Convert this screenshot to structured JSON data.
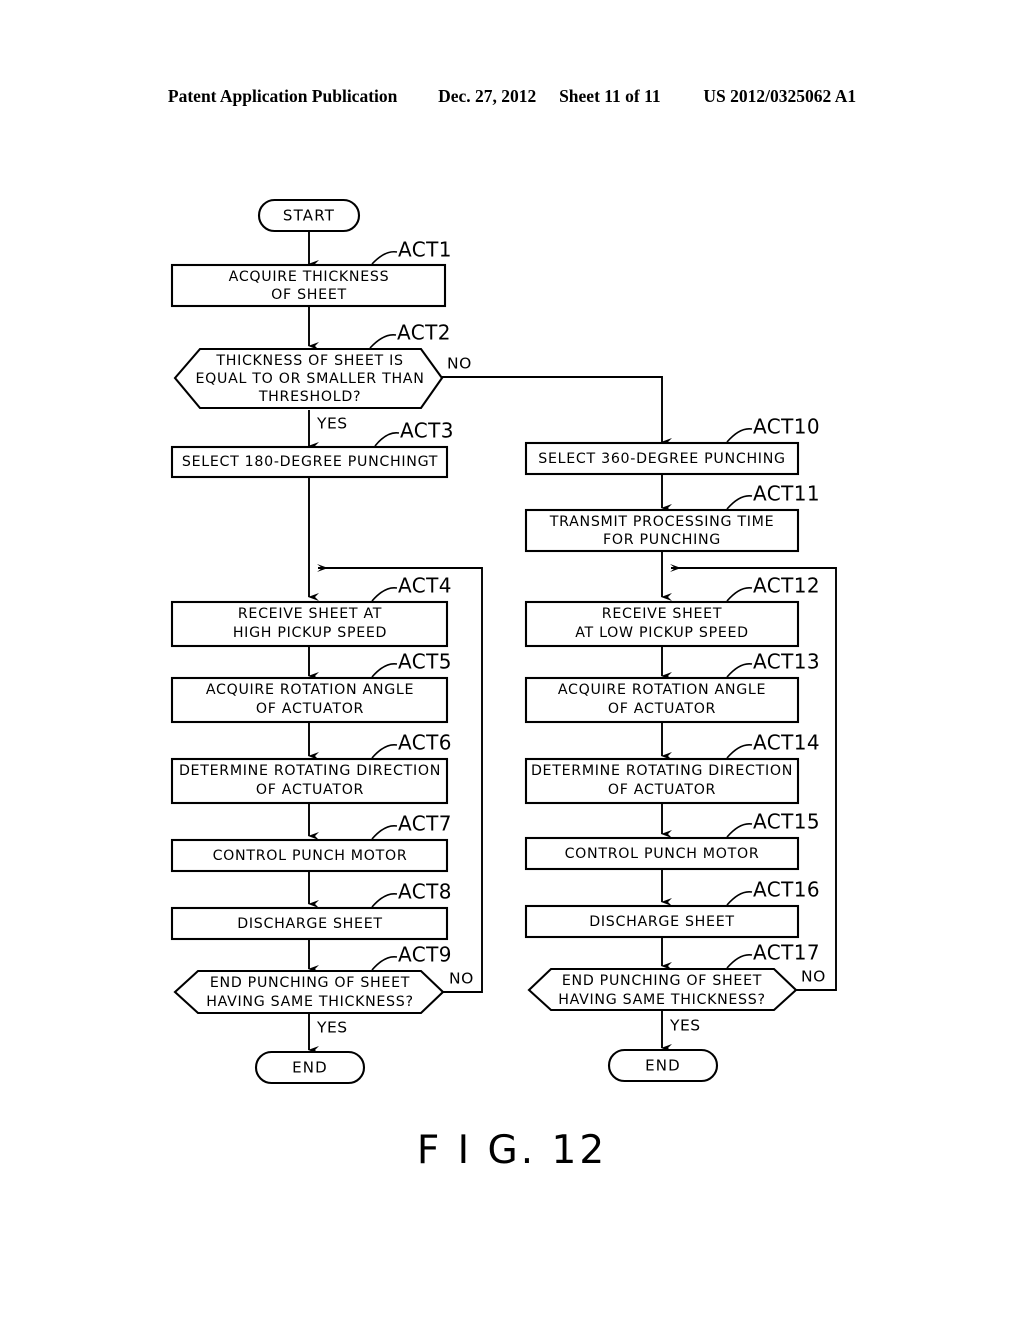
{
  "header": {
    "publication": "Patent Application Publication",
    "date": "Dec. 27, 2012",
    "sheet": "Sheet 11 of 11",
    "docnum": "US 2012/0325062 A1"
  },
  "figure": {
    "caption": "F I G. 12"
  },
  "terminals": {
    "start": "START",
    "end_left": "END",
    "end_right": "END"
  },
  "branch_labels": {
    "act2_no": "NO",
    "act2_yes": "YES",
    "act9_no": "NO",
    "act9_yes": "YES",
    "act17_no": "NO",
    "act17_yes": "YES"
  },
  "nodes": {
    "act1": {
      "tag": "ACT1",
      "line1": "ACQUIRE THICKNESS",
      "line2": "OF SHEET"
    },
    "act2": {
      "tag": "ACT2",
      "line1": "THICKNESS OF SHEET IS",
      "line2": "EQUAL TO OR SMALLER THAN",
      "line3": "THRESHOLD?"
    },
    "act3": {
      "tag": "ACT3",
      "line1": "SELECT 180-DEGREE PUNCHINGT"
    },
    "act4": {
      "tag": "ACT4",
      "line1": "RECEIVE SHEET AT",
      "line2": "HIGH PICKUP SPEED"
    },
    "act5": {
      "tag": "ACT5",
      "line1": "ACQUIRE ROTATION ANGLE",
      "line2": "OF ACTUATOR"
    },
    "act6": {
      "tag": "ACT6",
      "line1": "DETERMINE ROTATING DIRECTION",
      "line2": "OF ACTUATOR"
    },
    "act7": {
      "tag": "ACT7",
      "line1": "CONTROL PUNCH MOTOR"
    },
    "act8": {
      "tag": "ACT8",
      "line1": "DISCHARGE SHEET"
    },
    "act9": {
      "tag": "ACT9",
      "line1": "END PUNCHING OF SHEET",
      "line2": "HAVING SAME THICKNESS?"
    },
    "act10": {
      "tag": "ACT10",
      "line1": "SELECT 360-DEGREE PUNCHING"
    },
    "act11": {
      "tag": "ACT11",
      "line1": "TRANSMIT PROCESSING TIME",
      "line2": "FOR PUNCHING"
    },
    "act12": {
      "tag": "ACT12",
      "line1": "RECEIVE SHEET",
      "line2": "AT LOW PICKUP SPEED"
    },
    "act13": {
      "tag": "ACT13",
      "line1": "ACQUIRE ROTATION ANGLE",
      "line2": "OF ACTUATOR"
    },
    "act14": {
      "tag": "ACT14",
      "line1": "DETERMINE ROTATING DIRECTION",
      "line2": "OF ACTUATOR"
    },
    "act15": {
      "tag": "ACT15",
      "line1": "CONTROL PUNCH MOTOR"
    },
    "act16": {
      "tag": "ACT16",
      "line1": "DISCHARGE SHEET"
    },
    "act17": {
      "tag": "ACT17",
      "line1": "END PUNCHING OF SHEET",
      "line2": "HAVING SAME THICKNESS?"
    }
  },
  "colors": {
    "ink": "#000000",
    "paper": "#ffffff"
  }
}
